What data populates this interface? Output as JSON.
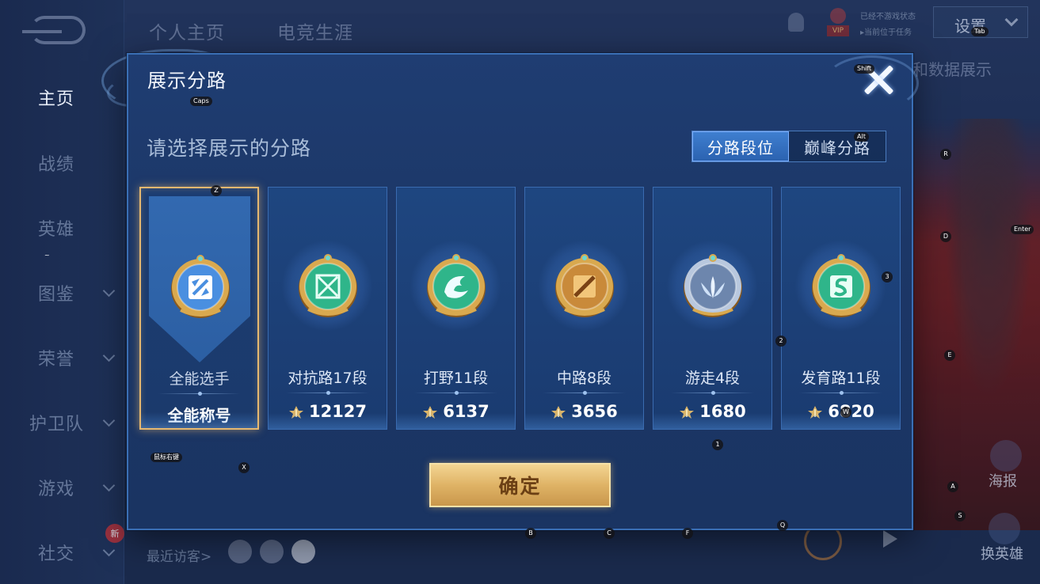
{
  "nav": {
    "items": [
      {
        "label": "主页",
        "active": true,
        "has_chevron": false
      },
      {
        "label": "战绩",
        "active": false,
        "has_chevron": false
      },
      {
        "label": "英雄",
        "active": false,
        "has_chevron": false
      },
      {
        "label": "图鉴",
        "active": false,
        "has_chevron": true
      },
      {
        "label": "荣誉",
        "active": false,
        "has_chevron": true
      },
      {
        "label": "护卫队",
        "active": false,
        "has_chevron": true
      },
      {
        "label": "游戏",
        "active": false,
        "has_chevron": true
      },
      {
        "label": "社交",
        "active": false,
        "has_chevron": true
      }
    ],
    "new_badge": "新"
  },
  "top_tabs": [
    "个人主页",
    "电竞生涯"
  ],
  "top_right": {
    "vip_label": "VIP",
    "status_line1": "已经不游戏状态",
    "status_line2": "▸当前位于任务",
    "settings_label": "设置"
  },
  "background": {
    "hint_text": "和数据展示",
    "poster_label": "海报",
    "change_hero_label": "换英雄",
    "recent_visitors_label": "最近访客>"
  },
  "modal": {
    "title": "展示分路",
    "prompt": "请选择展示的分路",
    "toggle": {
      "options": [
        "分路段位",
        "巅峰分路"
      ],
      "selected": "分路段位"
    },
    "confirm_label": "确定"
  },
  "cards": [
    {
      "name": "全能选手",
      "value": "全能称号",
      "selected": true,
      "emblem": "all-round-icon",
      "color": "#4a8fe0"
    },
    {
      "name": "对抗路17段",
      "value": "12127",
      "selected": false,
      "emblem": "clash-lane-icon",
      "color": "#2fb58a"
    },
    {
      "name": "打野11段",
      "value": "6137",
      "selected": false,
      "emblem": "jungle-icon",
      "color": "#2fb58a"
    },
    {
      "name": "中路8段",
      "value": "3656",
      "selected": false,
      "emblem": "mid-lane-icon",
      "color": "#c98a3a"
    },
    {
      "name": "游走4段",
      "value": "1680",
      "selected": false,
      "emblem": "roam-icon",
      "color": "#a9bcd8"
    },
    {
      "name": "发育路11段",
      "value": "6820",
      "selected": false,
      "emblem": "farm-lane-icon",
      "color": "#2fb58a"
    }
  ],
  "key_hints": {
    "caps": "Caps",
    "shift": "Shift",
    "tab": "Tab",
    "alt": "Alt",
    "enter": "Enter",
    "mouse_right": "鼠标右键",
    "z": "Z",
    "x": "X",
    "r": "R",
    "d": "D",
    "e": "E",
    "a": "A",
    "s": "S",
    "w": "W",
    "b": "B",
    "c": "C",
    "f": "F",
    "q": "Q",
    "one": "1",
    "two": "2",
    "three": "3",
    "tilde": "~"
  }
}
